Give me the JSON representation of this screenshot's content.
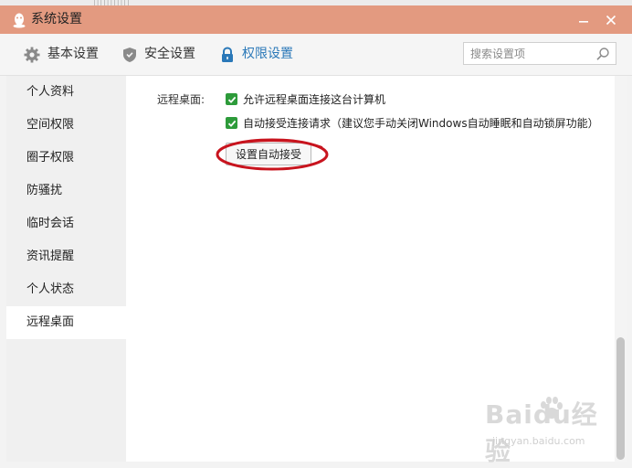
{
  "titlebar": {
    "title": "系统设置",
    "minimize_icon": "minimize-icon",
    "close_icon": "close-icon"
  },
  "tabs": [
    {
      "label": "基本设置",
      "icon": "gear-icon",
      "active": false
    },
    {
      "label": "安全设置",
      "icon": "shield-icon",
      "active": false
    },
    {
      "label": "权限设置",
      "icon": "lock-icon",
      "active": true
    }
  ],
  "search": {
    "placeholder": "搜索设置项",
    "icon": "search-icon"
  },
  "sidebar": {
    "items": [
      {
        "label": "个人资料"
      },
      {
        "label": "空间权限"
      },
      {
        "label": "圈子权限"
      },
      {
        "label": "防骚扰"
      },
      {
        "label": "临时会话"
      },
      {
        "label": "资讯提醒"
      },
      {
        "label": "个人状态"
      },
      {
        "label": "远程桌面",
        "active": true
      }
    ]
  },
  "remote": {
    "label": "远程桌面:",
    "option1": "允许远程桌面连接这台计算机",
    "option2": "自动接受连接请求（建议您手动关闭Windows自动睡眠和自动锁屏功能）",
    "option1_checked": true,
    "option2_checked": true,
    "button_label": "设置自动接受"
  },
  "watermark": {
    "brand": "Baidu经验",
    "url": "jingyan.baidu.com"
  },
  "colors": {
    "titlebar": "#e39a80",
    "accent": "#2a78b8",
    "checkbox": "#2d9b3a",
    "annotation": "#c8141e"
  }
}
